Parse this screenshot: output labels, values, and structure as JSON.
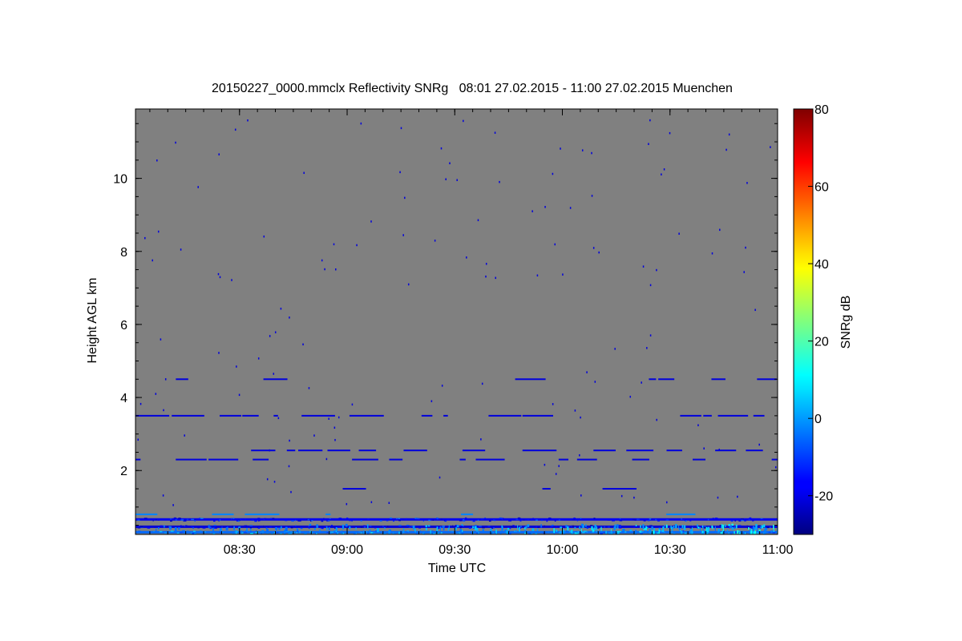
{
  "chart_data": {
    "type": "heatmap",
    "title": "20150227_0000.mmclx Reflectivity SNRg   08:01 27.02.2015 - 11:00 27.02.2015 Muenchen",
    "xlabel": "Time UTC",
    "ylabel": "Height AGL km",
    "xlim": [
      "08:01",
      "11:00"
    ],
    "ylim": [
      0.25,
      11.9
    ],
    "x_ticks": [
      "08:30",
      "09:00",
      "09:30",
      "10:00",
      "10:30",
      "11:00"
    ],
    "y_ticks": [
      2,
      4,
      6,
      8,
      10
    ],
    "background_color": "#808080",
    "colorbar": {
      "label": "SNRg dB",
      "range": [
        -30,
        80
      ],
      "ticks": [
        -20,
        0,
        20,
        40,
        60,
        80
      ],
      "colormap": "jet"
    },
    "echo_layers": [
      {
        "height_km": 0.3,
        "snr_db": -5,
        "coverage": "continuous"
      },
      {
        "height_km": 0.45,
        "snr_db": -20,
        "coverage": "continuous"
      },
      {
        "height_km": 0.65,
        "snr_db": -18,
        "coverage": "continuous"
      },
      {
        "height_km": 0.8,
        "snr_db": -2,
        "coverage": "sparse"
      },
      {
        "height_km": 1.5,
        "snr_db": -20,
        "coverage": "sparse"
      },
      {
        "height_km": 2.3,
        "snr_db": -20,
        "coverage": "intermittent"
      },
      {
        "height_km": 2.55,
        "snr_db": -20,
        "coverage": "intermittent"
      },
      {
        "height_km": 3.5,
        "snr_db": -20,
        "coverage": "intermittent"
      },
      {
        "height_km": 4.5,
        "snr_db": -20,
        "coverage": "sparse"
      }
    ]
  }
}
